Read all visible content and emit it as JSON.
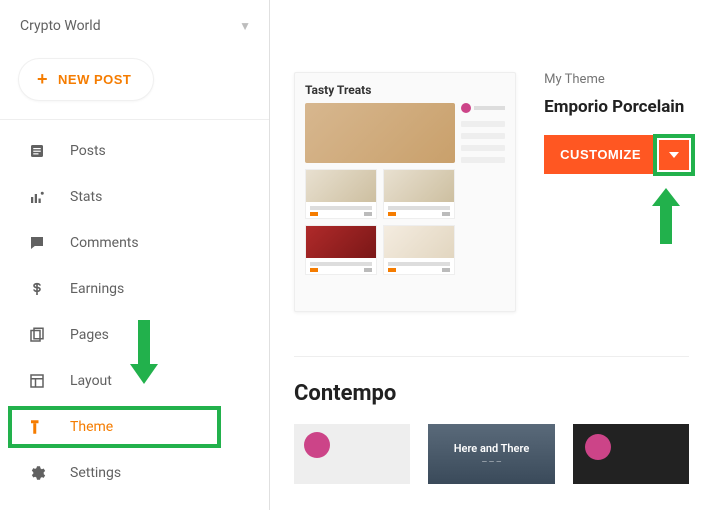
{
  "blog": {
    "name": "Crypto World"
  },
  "newPost": {
    "label": "NEW POST"
  },
  "nav": {
    "posts": "Posts",
    "stats": "Stats",
    "comments": "Comments",
    "earnings": "Earnings",
    "pages": "Pages",
    "layout": "Layout",
    "theme": "Theme",
    "settings": "Settings"
  },
  "myTheme": {
    "label": "My Theme",
    "name": "Emporio Porcelain",
    "customize": "CUSTOMIZE",
    "preview": {
      "title": "Tasty Treats"
    }
  },
  "gallery": {
    "title": "Contempo",
    "card2": {
      "title": "Here and There"
    }
  }
}
